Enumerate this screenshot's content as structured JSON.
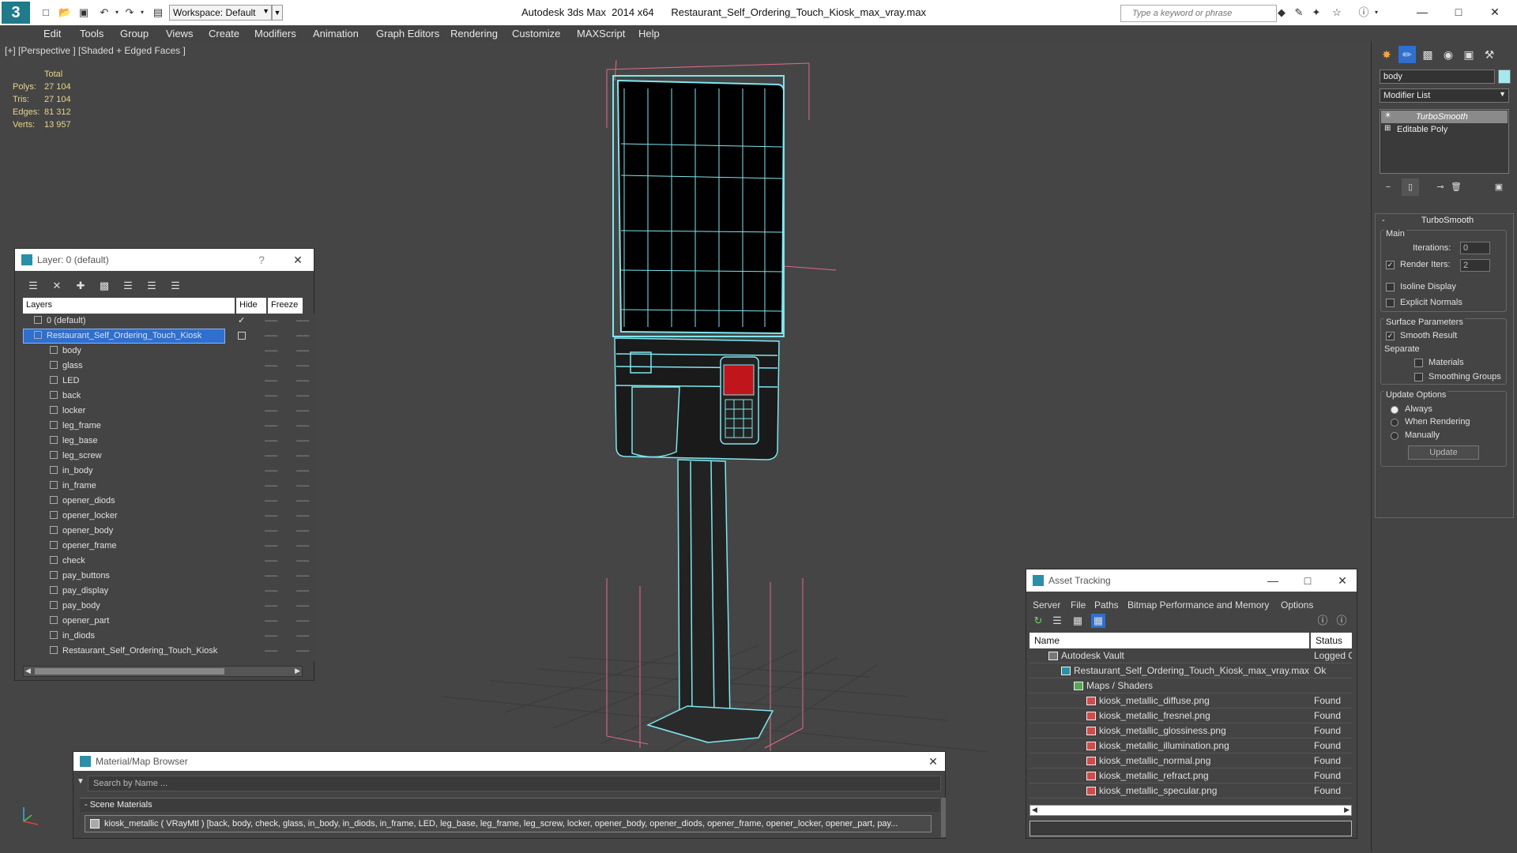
{
  "app": {
    "title": "Autodesk 3ds Max  2014 x64      Restaurant_Self_Ordering_Touch_Kiosk_max_vray.max",
    "workspace": "Workspace: Default",
    "search_placeholder": "Type a keyword or phrase"
  },
  "menu": [
    "Edit",
    "Tools",
    "Group",
    "Views",
    "Create",
    "Modifiers",
    "Animation",
    "Graph Editors",
    "Rendering",
    "Customize",
    "MAXScript",
    "Help"
  ],
  "viewport": {
    "label": "[+] [Perspective ] [Shaded + Edged Faces ]",
    "stats": {
      "header": "Total",
      "polys_label": "Polys:",
      "polys": "27 104",
      "tris_label": "Tris:",
      "tris": "27 104",
      "edges_label": "Edges:",
      "edges": "81 312",
      "verts_label": "Verts:",
      "verts": "13 957"
    }
  },
  "layer_dialog": {
    "title": "Layer: 0 (default)",
    "help": "?",
    "col_layers": "Layers",
    "col_hide": "Hide",
    "col_freeze": "Freeze",
    "layers": [
      {
        "name": "0 (default)",
        "level": 0
      },
      {
        "name": "Restaurant_Self_Ordering_Touch_Kiosk",
        "level": 0,
        "selected": true
      },
      {
        "name": "body",
        "level": 1
      },
      {
        "name": "glass",
        "level": 1
      },
      {
        "name": "LED",
        "level": 1
      },
      {
        "name": "back",
        "level": 1
      },
      {
        "name": "locker",
        "level": 1
      },
      {
        "name": "leg_frame",
        "level": 1
      },
      {
        "name": "leg_base",
        "level": 1
      },
      {
        "name": "leg_screw",
        "level": 1
      },
      {
        "name": "in_body",
        "level": 1
      },
      {
        "name": "in_frame",
        "level": 1
      },
      {
        "name": "opener_diods",
        "level": 1
      },
      {
        "name": "opener_locker",
        "level": 1
      },
      {
        "name": "opener_body",
        "level": 1
      },
      {
        "name": "opener_frame",
        "level": 1
      },
      {
        "name": "check",
        "level": 1
      },
      {
        "name": "pay_buttons",
        "level": 1
      },
      {
        "name": "pay_display",
        "level": 1
      },
      {
        "name": "pay_body",
        "level": 1
      },
      {
        "name": "opener_part",
        "level": 1
      },
      {
        "name": "in_diods",
        "level": 1
      },
      {
        "name": "Restaurant_Self_Ordering_Touch_Kiosk",
        "level": 1
      }
    ]
  },
  "asset_tracking": {
    "title": "Asset Tracking",
    "menu": [
      "Server",
      "File",
      "Paths",
      "Bitmap Performance and Memory",
      "Options"
    ],
    "col_name": "Name",
    "col_status": "Status",
    "rows": [
      {
        "name": "Autodesk Vault",
        "status": "Logged Out",
        "indent": 0,
        "icon": "vault"
      },
      {
        "name": "Restaurant_Self_Ordering_Touch_Kiosk_max_vray.max",
        "status": "Ok",
        "indent": 1,
        "icon": "max"
      },
      {
        "name": "Maps / Shaders",
        "status": "",
        "indent": 2,
        "icon": "maps"
      },
      {
        "name": "kiosk_metallic_diffuse.png",
        "status": "Found",
        "indent": 3,
        "icon": "png"
      },
      {
        "name": "kiosk_metallic_fresnel.png",
        "status": "Found",
        "indent": 3,
        "icon": "png"
      },
      {
        "name": "kiosk_metallic_glossiness.png",
        "status": "Found",
        "indent": 3,
        "icon": "png"
      },
      {
        "name": "kiosk_metallic_illumination.png",
        "status": "Found",
        "indent": 3,
        "icon": "png"
      },
      {
        "name": "kiosk_metallic_normal.png",
        "status": "Found",
        "indent": 3,
        "icon": "png"
      },
      {
        "name": "kiosk_metallic_refract.png",
        "status": "Found",
        "indent": 3,
        "icon": "png"
      },
      {
        "name": "kiosk_metallic_specular.png",
        "status": "Found",
        "indent": 3,
        "icon": "png"
      }
    ]
  },
  "material_browser": {
    "title": "Material/Map Browser",
    "search": "Search by Name ...",
    "section": "- Scene Materials",
    "entry": "kiosk_metallic ( VRayMtl ) [back, body, check, glass, in_body, in_diods, in_frame, LED, leg_base, leg_frame, leg_screw, locker, opener_body, opener_diods, opener_frame, opener_locker, opener_part, pay..."
  },
  "command_panel": {
    "object_name": "body",
    "modifier_list": "Modifier List",
    "stack": [
      "TurboSmooth",
      "Editable Poly"
    ],
    "rollout": "TurboSmooth",
    "main_group": "Main",
    "iterations_label": "Iterations:",
    "iterations": "0",
    "render_iters_label": "Render Iters:",
    "render_iters": "2",
    "isoline": "Isoline Display",
    "explicit_normals": "Explicit Normals",
    "surface_group": "Surface Parameters",
    "smooth_result": "Smooth Result",
    "separate": "Separate",
    "materials": "Materials",
    "smoothing_groups": "Smoothing Groups",
    "update_group": "Update Options",
    "always": "Always",
    "when_rendering": "When Rendering",
    "manually": "Manually",
    "update_button": "Update"
  },
  "colors": {
    "wire": "#7fe6ef",
    "bbox": "#e06a8a",
    "selection": "#2f6fce",
    "stats": "#e8d48a"
  }
}
